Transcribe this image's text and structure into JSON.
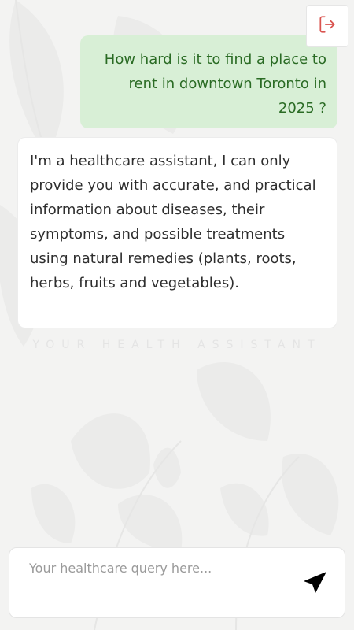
{
  "header": {
    "logout_icon": "logout-icon",
    "accent_color": "#d9534f"
  },
  "chat": {
    "messages": [
      {
        "role": "user",
        "text": "How hard is it to find a place to rent in downtown Toronto in 2025 ?"
      },
      {
        "role": "assistant",
        "text": "I'm a healthcare assistant, I can only provide you with accurate, and practical information about diseases, their symptoms, and possible treatments using natural remedies (plants, roots, herbs, fruits and vegetables)."
      }
    ],
    "watermark": "YOUR HEALTH ASSISTANT"
  },
  "composer": {
    "placeholder": "Your healthcare query here...",
    "value": "",
    "send_icon": "send-icon"
  },
  "colors": {
    "user_bubble": "#d8efd6",
    "user_text": "#2a6b24",
    "assistant_bubble": "#ffffff",
    "background": "#f3f3f2"
  }
}
